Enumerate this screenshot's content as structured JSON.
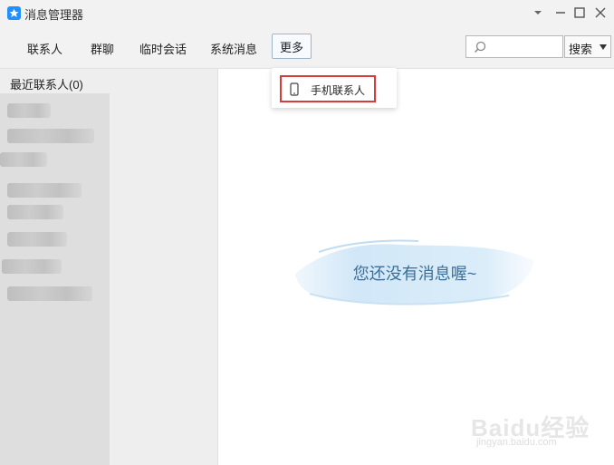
{
  "window": {
    "title": "消息管理器",
    "controls": [
      "dropdown",
      "maximize",
      "close"
    ]
  },
  "toolbar": {
    "tabs": [
      "联系人",
      "群聊",
      "临时会话",
      "系统消息"
    ],
    "more_label": "更多",
    "search": {
      "placeholder": "",
      "value": ""
    },
    "search_button_label": "搜索"
  },
  "dropdown": {
    "items": [
      {
        "label": "手机联系人",
        "icon": "phone-icon"
      }
    ]
  },
  "sidebar": {
    "recent_header": "最近联系人(0)"
  },
  "main": {
    "empty_message": "您还没有消息喔~"
  },
  "watermark": {
    "brand": "Baidu经验",
    "url": "jingyan.baidu.com"
  },
  "colors": {
    "accent": "#3b6f98",
    "highlight_border": "#d93b3b",
    "app_icon": "#1e90ff"
  }
}
